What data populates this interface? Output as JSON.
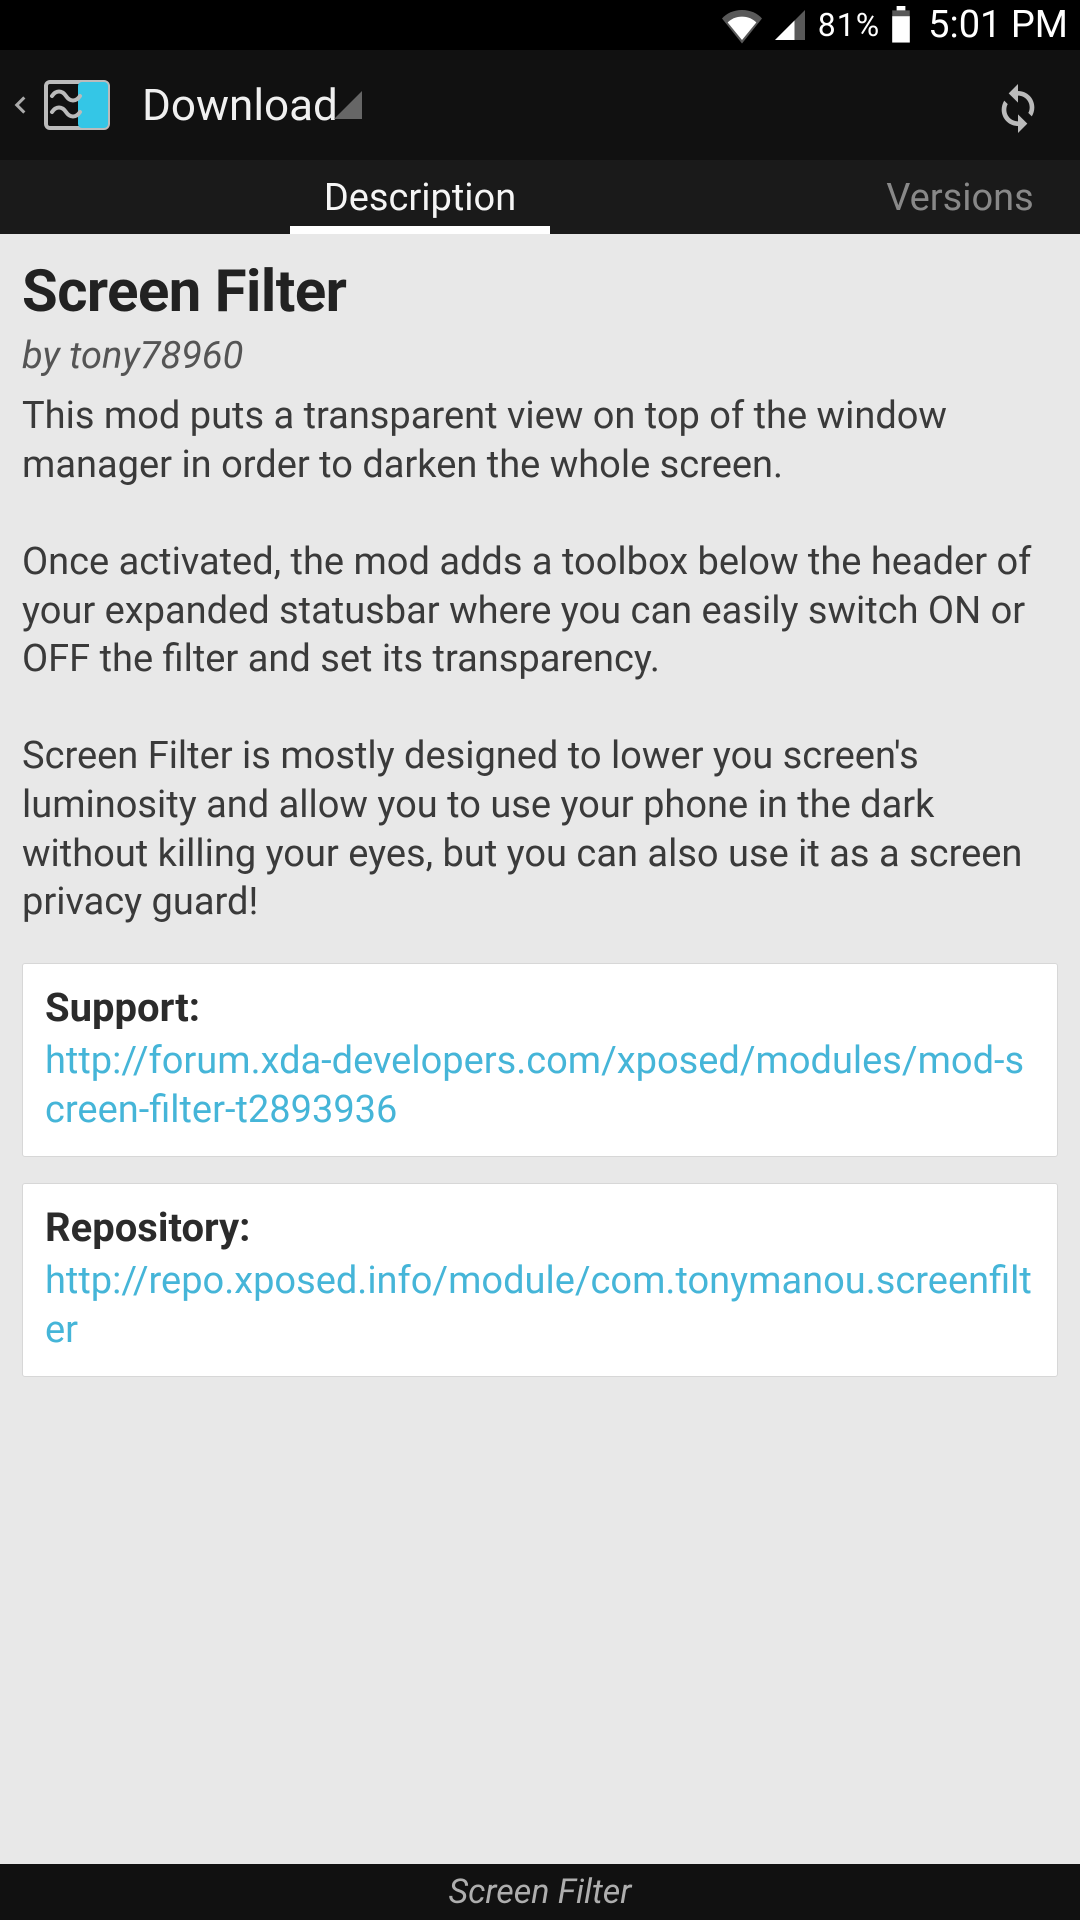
{
  "status": {
    "battery_pct": "81%",
    "time": "5:01 PM"
  },
  "actionbar": {
    "title": "Download"
  },
  "tabs": {
    "description": "Description",
    "versions": "Versions",
    "active": "description"
  },
  "module": {
    "title": "Screen Filter",
    "author": "by tony78960",
    "description": "This mod puts a transparent view on top of the window manager in order to darken the whole screen.\n\nOnce activated, the mod adds a toolbox below the header of your expanded statusbar where you can easily switch ON or OFF the filter and set its transparency.\n\nScreen Filter is mostly designed to lower you screen's luminosity and allow you to use your phone in the dark without killing your eyes, but you can also use it as a screen privacy guard!"
  },
  "cards": {
    "support": {
      "label": "Support:",
      "url": "http://forum.xda-developers.com/xposed/modules/mod-screen-filter-t2893936"
    },
    "repository": {
      "label": "Repository:",
      "url": "http://repo.xposed.info/module/com.tonymanou.screenfilter"
    }
  },
  "footer": {
    "text": "Screen Filter"
  },
  "colors": {
    "link": "#45b5d8",
    "bg": "#e8e8e8",
    "dark": "#111111"
  }
}
